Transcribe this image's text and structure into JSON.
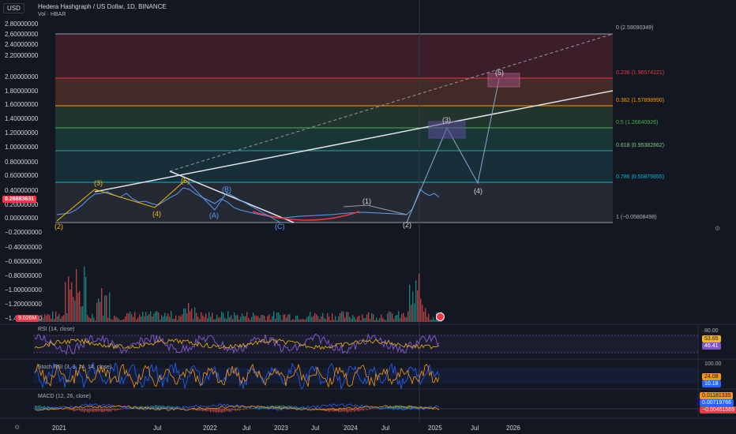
{
  "header": {
    "currency": "USD",
    "title": "Hedera Hashgraph / US Dollar, 1D, BINANCE",
    "vol_label": "Vol · HBAR"
  },
  "price_axis": [
    "2.80000000",
    "2.60000000",
    "2.40000000",
    "2.20000000",
    "2.00000000",
    "1.80000000",
    "1.60000000",
    "1.40000000",
    "1.20000000",
    "1.00000000",
    "0.80000000",
    "0.60000000",
    "0.40000000",
    "0.20000000",
    "0.00000000",
    "−0.20000000",
    "−0.40000000",
    "−0.60000000",
    "−0.80000000",
    "−1.00000000",
    "−1.20000000",
    "−1.40000000"
  ],
  "current_price": "0.26883631",
  "volume_badge": "9.026M",
  "time_axis": [
    "2021",
    "Jul",
    "2022",
    "Jul",
    "2023",
    "Jul",
    "2024",
    "Jul",
    "2025",
    "Jul",
    "2026"
  ],
  "fib_levels": [
    {
      "label": "0 (2.59090349)",
      "color": "#b2b5be"
    },
    {
      "label": "0.236 (1.96574221)",
      "color": "#f23645"
    },
    {
      "label": "0.382 (1.57898990)",
      "color": "#ff9800"
    },
    {
      "label": "0.5 (1.26640926)",
      "color": "#4caf50"
    },
    {
      "label": "0.618 (0.95382862)",
      "color": "#81c784"
    },
    {
      "label": "0.786 (0.50879855)",
      "color": "#00bcd4"
    },
    {
      "label": "1 (−0.05808498)",
      "color": "#b2b5be"
    }
  ],
  "wave_labels": [
    {
      "text": "(3)",
      "color": "#f0b90b"
    },
    {
      "text": "(4)",
      "color": "#f0b90b"
    },
    {
      "text": "(2)",
      "color": "#f0b90b"
    },
    {
      "text": "(5)",
      "color": "#f0b90b"
    },
    {
      "text": "(B)",
      "color": "#5b9cf6"
    },
    {
      "text": "(A)",
      "color": "#5b9cf6"
    },
    {
      "text": "(C)",
      "color": "#5b9cf6"
    },
    {
      "text": "(1)",
      "color": "#d1d4dc"
    },
    {
      "text": "(2)",
      "color": "#d1d4dc"
    },
    {
      "text": "(3)",
      "color": "#d1d4dc"
    },
    {
      "text": "(4)",
      "color": "#d1d4dc"
    },
    {
      "text": "(5)",
      "color": "#d1d4dc"
    }
  ],
  "rsi": {
    "title": "RSI (14, close)",
    "upper": "80.00",
    "lower": "",
    "val1": "53.65",
    "val2": "46.41"
  },
  "stoch": {
    "title": "Stoch RSI (3, 3, 14, 14, close)",
    "upper": "100.00",
    "val1": "24.08",
    "val2": "10.18"
  },
  "macd": {
    "title": "MACD (12, 26, close)",
    "val1": "0.01181335",
    "val2": "0.00719766",
    "val3": "−0.00461569"
  },
  "colors": {
    "bg": "#131722",
    "up": "#26a69a",
    "down": "#ef5350",
    "rsi": "#7e57c2",
    "stoch_k": "#2962ff",
    "stoch_d": "#ff9800"
  }
}
